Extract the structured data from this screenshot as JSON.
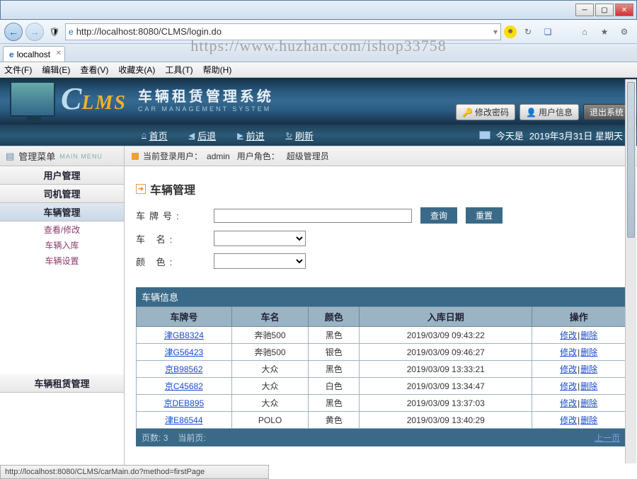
{
  "window": {
    "url": "http://localhost:8080/CLMS/login.do",
    "tab_title": "localhost",
    "watermark": "https://www.huzhan.com/ishop33758"
  },
  "browser_menu": [
    "文件(F)",
    "编辑(E)",
    "查看(V)",
    "收藏夹(A)",
    "工具(T)",
    "帮助(H)"
  ],
  "banner": {
    "logo_c": "C",
    "logo_lms": "LMS",
    "title_cn": "车辆租赁管理系统",
    "title_en": "CAR   MANAGEMENT   SYSTEM",
    "btn_password": "修改密码",
    "btn_userinfo": "用户信息",
    "btn_logout": "退出系统"
  },
  "appnav": {
    "links": [
      "首页",
      "后退",
      "前进",
      "刷新"
    ],
    "date_prefix": "今天是",
    "date": "2019年3月31日 星期天"
  },
  "sidebar": {
    "header": "管理菜单",
    "header_en": "MAIN MENU",
    "items": [
      "用户管理",
      "司机管理",
      "车辆管理"
    ],
    "subs": [
      "查看/修改",
      "车辆入库",
      "车辆设置"
    ],
    "bottom": "车辆租赁管理"
  },
  "crumb": {
    "prefix": "当前登录用户：",
    "user": "admin",
    "role_label": "用户角色：",
    "role": "超级管理员"
  },
  "page": {
    "title": "车辆管理",
    "label_plate": "车牌号:",
    "label_name": "车  名:",
    "label_color": "颜  色:",
    "btn_query": "查询",
    "btn_reset": "重置"
  },
  "table": {
    "title": "车辆信息",
    "headers": [
      "车牌号",
      "车名",
      "颜色",
      "入库日期",
      "操作"
    ],
    "op_edit": "修改",
    "op_del": "删除",
    "rows": [
      {
        "plate": "津GB8324",
        "name": "奔驰500",
        "color": "黑色",
        "date": "2019/03/09 09:43:22"
      },
      {
        "plate": "津G56423",
        "name": "奔驰500",
        "color": "银色",
        "date": "2019/03/09 09:46:27"
      },
      {
        "plate": "京B98562",
        "name": "大众",
        "color": "黑色",
        "date": "2019/03/09 13:33:21"
      },
      {
        "plate": "京C45682",
        "name": "大众",
        "color": "白色",
        "date": "2019/03/09 13:34:47"
      },
      {
        "plate": "京DEB895",
        "name": "大众",
        "color": "黑色",
        "date": "2019/03/09 13:37:03"
      },
      {
        "plate": "津E86544",
        "name": "POLO",
        "color": "黄色",
        "date": "2019/03/09 13:40:29"
      }
    ]
  },
  "pager": {
    "pages_label": "页数:",
    "pages": "3",
    "current_label": "当前页:",
    "prev": "上一页"
  },
  "status": "http://localhost:8080/CLMS/carMain.do?method=firstPage"
}
